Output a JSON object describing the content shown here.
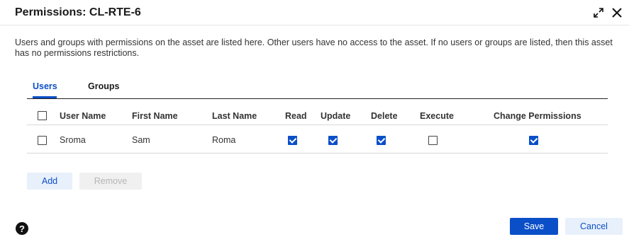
{
  "dialog": {
    "title": "Permissions: CL-RTE-6",
    "expand_icon": "expand-icon",
    "close_icon": "close-icon",
    "description": "Users and groups with permissions on the asset are listed here. Other users have no access to the asset. If no users or groups are listed, then this asset has no permissions restrictions."
  },
  "tabs": [
    {
      "label": "Users",
      "active": true
    },
    {
      "label": "Groups",
      "active": false
    }
  ],
  "table": {
    "columns": [
      "User Name",
      "First Name",
      "Last Name",
      "Read",
      "Update",
      "Delete",
      "Execute",
      "Change Permissions"
    ],
    "select_all_checked": false,
    "rows": [
      {
        "selected": false,
        "user_name": "Sroma",
        "first_name": "Sam",
        "last_name": "Roma",
        "read": true,
        "update": true,
        "delete": true,
        "execute": false,
        "change_permissions": true
      }
    ]
  },
  "buttons": {
    "add": "Add",
    "remove": "Remove",
    "save": "Save",
    "cancel": "Cancel"
  },
  "help_icon": "help-icon",
  "colors": {
    "accent": "#0b4fc8",
    "accent_light": "#e8f0fb",
    "disabled_bg": "#f0f0f0",
    "disabled_text": "#b5b5b5"
  }
}
